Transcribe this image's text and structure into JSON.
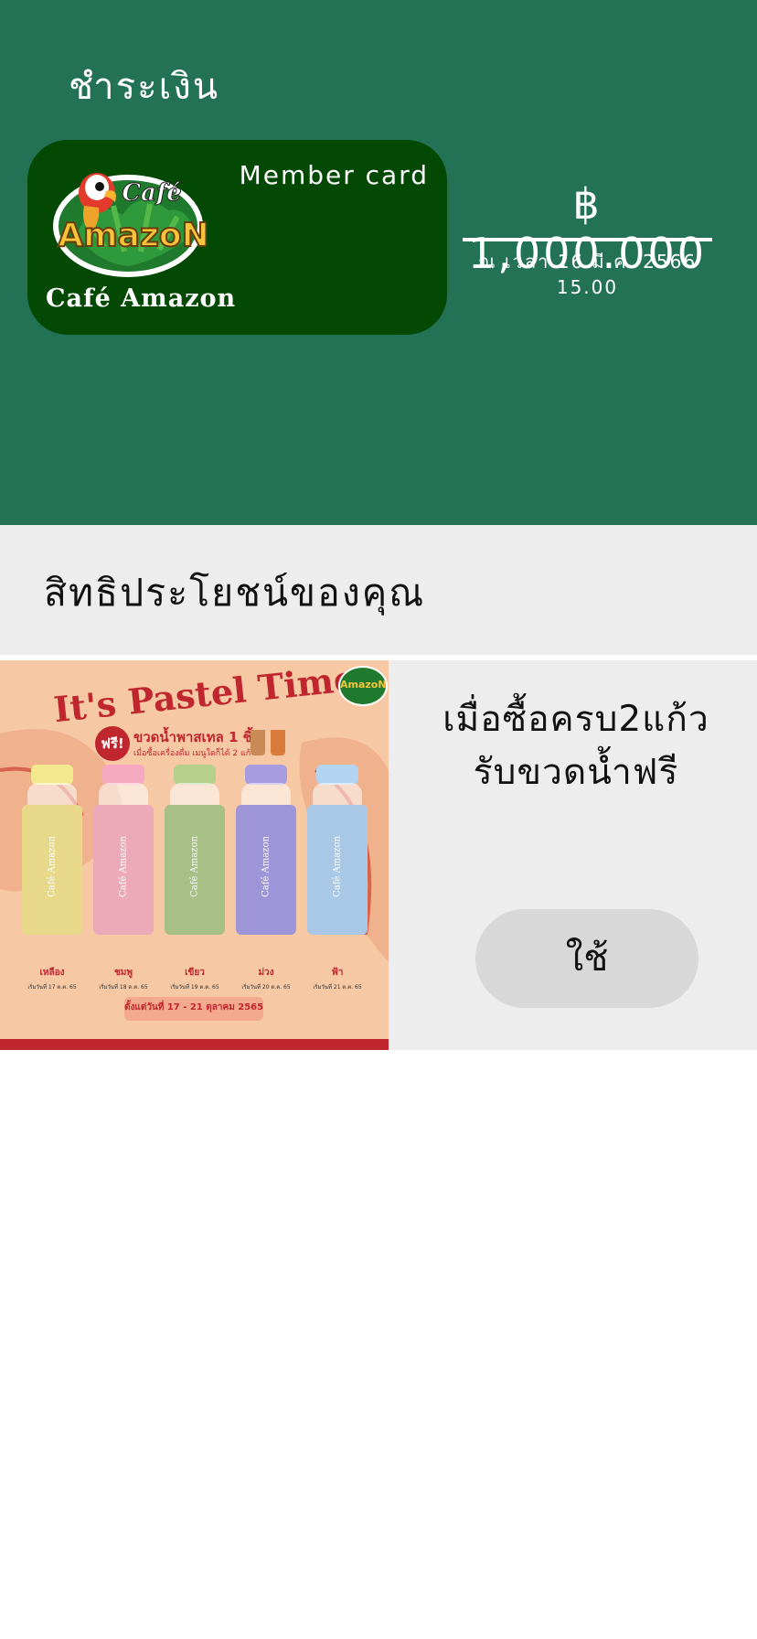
{
  "header": {
    "title": "ชำระเงิน"
  },
  "card": {
    "label": "Member card",
    "brand_name": "Café Amazon",
    "logo_text_top": "Café",
    "logo_text_main": "AmazoN"
  },
  "balance": {
    "amount": "฿ 1,000.000",
    "timestamp": "ณ เวลา 16 มี.ค. 2566 15.00"
  },
  "benefits": {
    "title": "สิทธิประโยชน์ของคุณ"
  },
  "promo": {
    "line1": "เมื่อซื้อครบ2แก้ว",
    "line2": "รับขวดน้ำฟรี",
    "use_button": "ใช้",
    "poster": {
      "headline": "It's Pastel Time",
      "free_badge": "ฟรี!",
      "offer": "ขวดน้ำพาสเทล 1 ชิ้น",
      "offer_sub": "เมื่อซื้อเครื่องดื่ม เมนูใดก็ได้ 2 แก้ว",
      "bottle_label": "Café Amazon",
      "colors": [
        {
          "name": "เหลือง",
          "date": "เริ่มวันที่ 17 ต.ค. 65",
          "hex": "#e8d98a",
          "cap": "#f3e88e"
        },
        {
          "name": "ชมพู",
          "date": "เริ่มวันที่ 18 ต.ค. 65",
          "hex": "#ecaab8",
          "cap": "#f4a9c0"
        },
        {
          "name": "เขียว",
          "date": "เริ่มวันที่ 19 ต.ค. 65",
          "hex": "#a8bf86",
          "cap": "#b6d08c"
        },
        {
          "name": "ม่วง",
          "date": "เริ่มวันที่ 20 ต.ค. 65",
          "hex": "#9d95d8",
          "cap": "#a89ce0"
        },
        {
          "name": "ฟ้า",
          "date": "เริ่มวันที่ 21 ต.ค. 65",
          "hex": "#a9c8e6",
          "cap": "#b2d4f0"
        }
      ],
      "date_range": "ตั้งแต่วันที่ 17 - 21 ตุลาคม 2565",
      "logo_text": "AmazoN"
    }
  },
  "colors": {
    "header_bg": "#247256",
    "card_bg": "#034903",
    "panel_bg": "#ededed",
    "button_bg": "#d8d8d8",
    "poster_bg": "#f6c8a4",
    "poster_red": "#c0262e"
  }
}
